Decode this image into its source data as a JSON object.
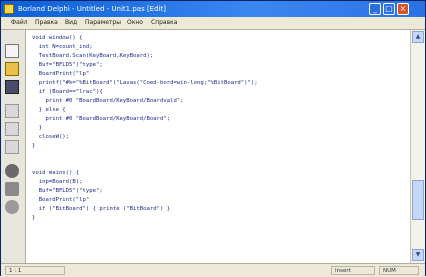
{
  "window": {
    "title": "Borland Delphi - Untitled - Unit1.pas [Edit]",
    "controls": {
      "minimize": "_",
      "maximize": "□",
      "close": "×"
    }
  },
  "menu": [
    "Файл",
    "Правка",
    "Вид",
    "Параметры",
    "Окно",
    "Справка"
  ],
  "toolbar": {
    "icons": [
      "new-icon",
      "open-icon",
      "save-icon",
      "cut-icon",
      "copy-icon",
      "paste-icon",
      "run-icon",
      "search-icon",
      "help-icon"
    ]
  },
  "editor": {
    "lines": [
      "void window() {",
      "  int N=count_ind;",
      "  TestBoard.Scan(KeyBoard,KeyBoard);",
      "  Buf=\"BFLD5\"(\"type\";",
      "  BoardPrint(\"lp\"",
      "  printf(\"#k=\"%BitBoard\"(\"Lavas(\"Coed-bord=win-long;\"%BitBoard\")\");",
      "  if (Board==\"lrac\"){",
      "    print #0 \"BoardBoard/KeyBoard/Boardvald\";",
      "  } else {",
      "    print #0 \"BoardBoard/KeyBoard/Board\";",
      "  }",
      "  closeW();",
      "}",
      "",
      "",
      "void mains() {",
      "  inp=Board(B);",
      "  Buf=\"BFLD5\"(\"type\";",
      "  BoardPrint(\"lp\"",
      "  if (\"BitBoard\") { printe (\"BitBoard\") }",
      "}"
    ]
  },
  "status": {
    "position": "1 : 1",
    "mode": "Insert",
    "extra": "NUM"
  }
}
